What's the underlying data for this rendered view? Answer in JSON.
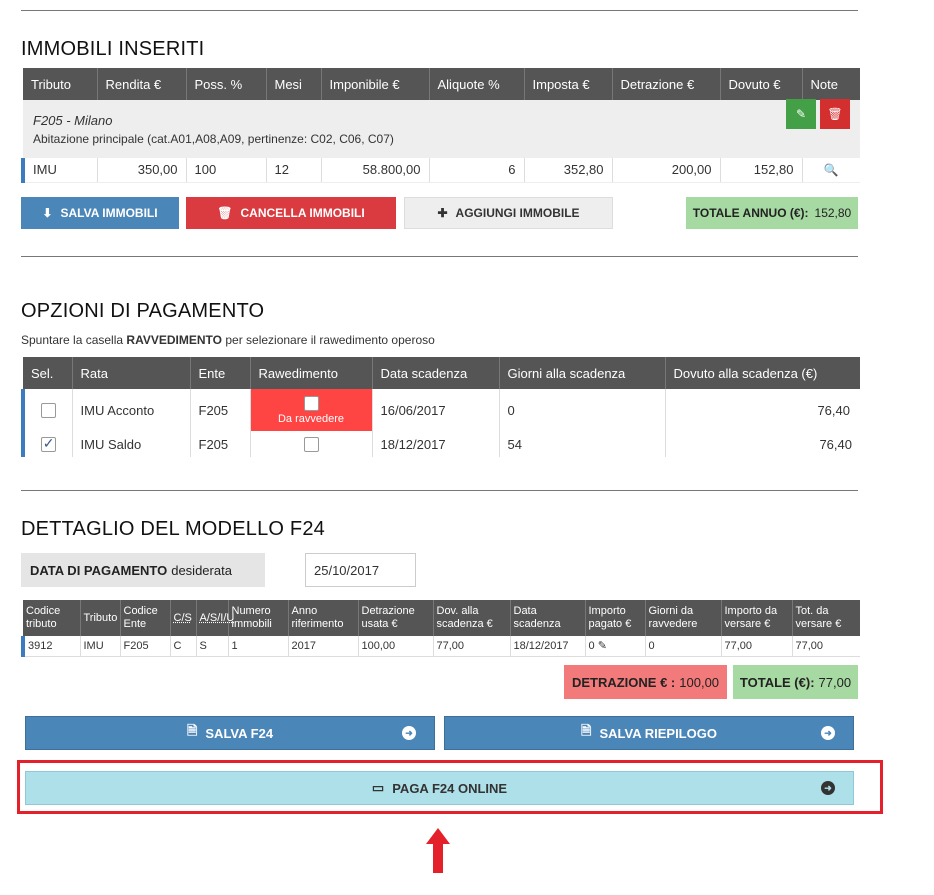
{
  "immobili": {
    "title": "IMMOBILI INSERITI",
    "headers": [
      "Tributo",
      "Rendita €",
      "Poss. %",
      "Mesi",
      "Imponibile €",
      "Aliquote %",
      "Imposta €",
      "Detrazione €",
      "Dovuto €",
      "Note"
    ],
    "group": {
      "city": "F205 - Milano",
      "desc": "Abitazione principale (cat.A01,A08,A09, pertinenze: C02, C06, C07)"
    },
    "row": [
      "IMU",
      "350,00",
      "100",
      "12",
      "58.800,00",
      "6",
      "352,80",
      "200,00",
      "152,80"
    ],
    "buttons": {
      "save": "SALVA IMMOBILI",
      "delete": "CANCELLA IMMOBILI",
      "add": "AGGIUNGI IMMOBILE"
    },
    "total_label": "TOTALE ANNUO (€):",
    "total_value": "152,80"
  },
  "opzioni": {
    "title": "OPZIONI DI PAGAMENTO",
    "subtitle_pre": "Spuntare la casella",
    "subtitle_bold": "RAVVEDIMENTO",
    "subtitle_post": "per selezionare il rawedimento operoso",
    "headers": [
      "Sel.",
      "Rata",
      "Ente",
      "Rawedimento",
      "Data scadenza",
      "Giorni alla scadenza",
      "Dovuto alla scadenza (€)"
    ],
    "rows": [
      {
        "rata": "IMU Acconto",
        "ente": "F205",
        "ravv_label": "Da ravvedere",
        "data": "16/06/2017",
        "giorni": "0",
        "dovuto": "76,40",
        "selected": false
      },
      {
        "rata": "IMU Saldo",
        "ente": "F205",
        "ravv_label": "",
        "data": "18/12/2017",
        "giorni": "54",
        "dovuto": "76,40",
        "selected": true
      }
    ]
  },
  "f24": {
    "title": "DETTAGLIO DEL MODELLO F24",
    "date_label_bold": "DATA DI PAGAMENTO",
    "date_label_rest": "desiderata",
    "date_value": "25/10/2017",
    "headers": {
      "codice_tributo": "Codice tributo",
      "tributo": "Tributo",
      "codice_ente": "Codice Ente",
      "cs": "C/S",
      "asiu": "A/S/I/U",
      "numero": "Numero immobili",
      "anno": "Anno riferimento",
      "detrazione": "Detrazione usata €",
      "dov": "Dov. alla scadenza €",
      "data": "Data scadenza",
      "importo": "Importo pagato €",
      "giorni": "Giorni da ravvedere",
      "versare": "Importo da versare €",
      "tot": "Tot. da versare €"
    },
    "row": [
      "3912",
      "IMU",
      "F205",
      "C",
      "S",
      "1",
      "2017",
      "100,00",
      "77,00",
      "18/12/2017",
      "0",
      "0",
      "77,00",
      "77,00"
    ],
    "detrazione_label": "DETRAZIONE € :",
    "detrazione_value": "100,00",
    "totale_label": "TOTALE (€):",
    "totale_value": "77,00",
    "buttons": {
      "salva_f24": "SALVA F24",
      "salva_riepilogo": "SALVA RIEPILOGO",
      "paga": "PAGA F24 ONLINE"
    }
  },
  "colors": {
    "accent_blue": "#4b86b9",
    "danger_red": "#d93b40",
    "success_green": "#a7d9a3",
    "highlight_red": "#e4212a",
    "light_cyan": "#aee0ea"
  }
}
